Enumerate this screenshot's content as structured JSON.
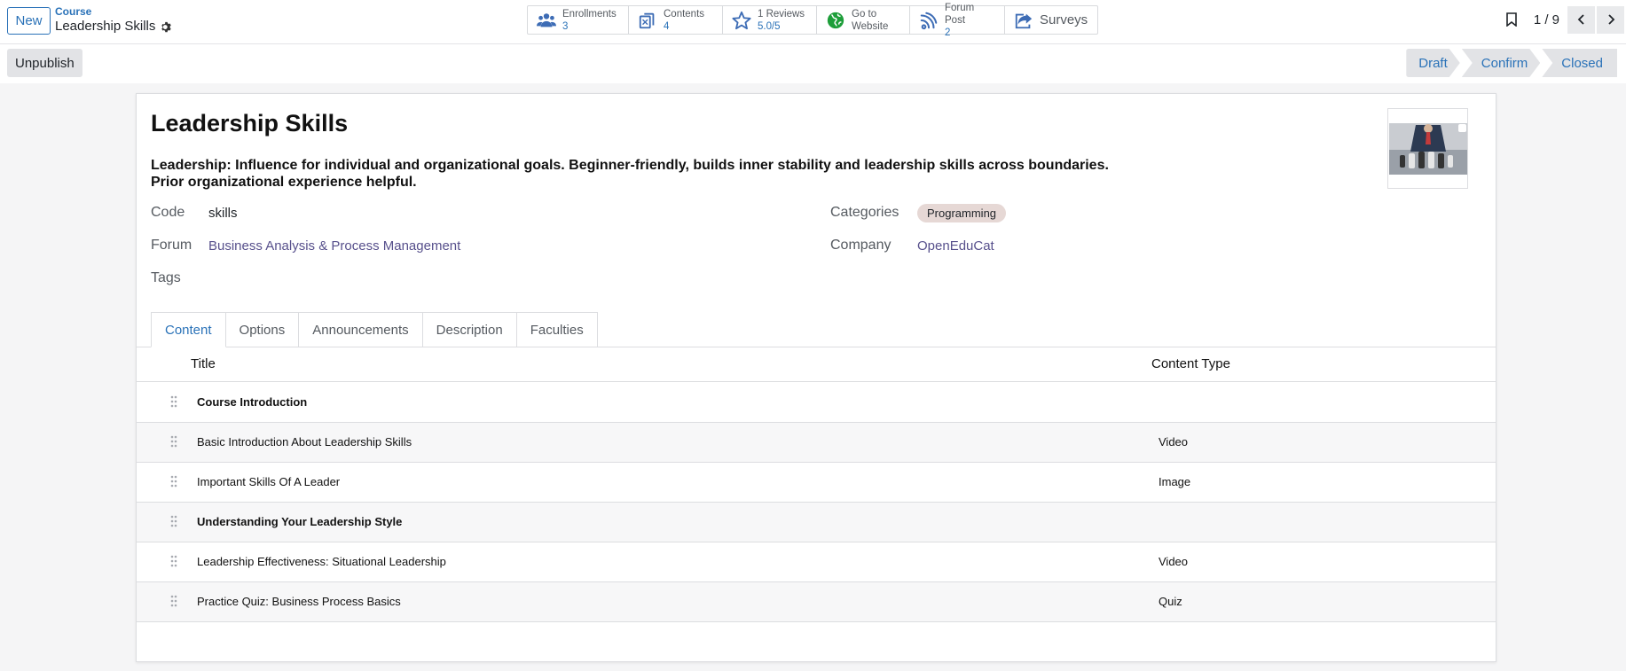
{
  "controlPanel": {
    "new_label": "New",
    "breadcrumb_parent": "Course",
    "breadcrumb_current": "Leadership Skills",
    "smartButtons": [
      {
        "icon": "users-icon",
        "label": "Enrollments",
        "value": "3"
      },
      {
        "icon": "documents-icon",
        "label": "Contents",
        "value": "4"
      },
      {
        "icon": "star-icon",
        "label": "1 Reviews",
        "value": "5.0/5"
      },
      {
        "icon": "globe-icon",
        "label": "Go to",
        "value": "Website"
      },
      {
        "icon": "rss-icon",
        "label": "Forum Post",
        "value": "2"
      },
      {
        "icon": "share-icon",
        "label": "Surveys"
      }
    ],
    "pager": "1 / 9"
  },
  "statusbar": {
    "unpublish_label": "Unpublish",
    "stages": [
      "Draft",
      "Confirm",
      "Closed"
    ]
  },
  "form": {
    "title": "Leadership Skills",
    "subtitle": "Leadership: Influence for individual and organizational goals. Beginner-friendly, builds inner stability and leadership skills across boundaries. Prior organizational experience helpful.",
    "fields": {
      "code_label": "Code",
      "code_value": "skills",
      "forum_label": "Forum",
      "forum_value": "Business Analysis & Process Management",
      "tags_label": "Tags",
      "categories_label": "Categories",
      "categories_value": "Programming",
      "company_label": "Company",
      "company_value": "OpenEduCat"
    },
    "tabs": [
      "Content",
      "Options",
      "Announcements",
      "Description",
      "Faculties"
    ],
    "table": {
      "headers": [
        "Title",
        "Content Type"
      ],
      "rows": [
        {
          "title": "Course Introduction",
          "type": "",
          "section": true
        },
        {
          "title": "Basic Introduction About Leadership Skills",
          "type": "Video",
          "section": false
        },
        {
          "title": "Important Skills Of A Leader",
          "type": "Image",
          "section": false
        },
        {
          "title": "Understanding Your Leadership Style",
          "type": "",
          "section": true
        },
        {
          "title": "Leadership Effectiveness: Situational Leadership",
          "type": "Video",
          "section": false
        },
        {
          "title": "Practice Quiz: Business Process Basics",
          "type": "Quiz",
          "section": false
        }
      ]
    }
  },
  "colors": {
    "accent": "#2a72b8",
    "link": "#57508c",
    "tag": "#e6d8d5"
  }
}
